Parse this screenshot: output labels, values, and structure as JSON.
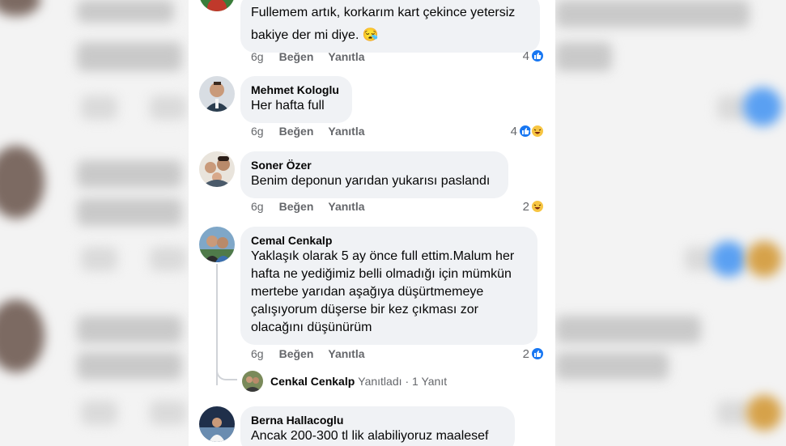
{
  "comments": [
    {
      "author": "",
      "lines": [
        "Fullemem artık, korkarım kart çekince yetersiz",
        "bakiye der mi diye. 😪"
      ],
      "time": "6g",
      "like_label": "Beğen",
      "reply_label": "Yanıtla",
      "reaction_count": "4",
      "reactions": [
        "like-icon"
      ]
    },
    {
      "author": "Mehmet Kologlu",
      "lines": [
        "Her hafta full"
      ],
      "time": "6g",
      "like_label": "Beğen",
      "reply_label": "Yanıtla",
      "reaction_count": "4",
      "reactions": [
        "like-icon",
        "haha-icon"
      ]
    },
    {
      "author": "Soner Özer",
      "lines": [
        "Benim deponun yarıdan yukarısı paslandı"
      ],
      "time": "6g",
      "like_label": "Beğen",
      "reply_label": "Yanıtla",
      "reaction_count": "2",
      "reactions": [
        "haha-icon"
      ]
    },
    {
      "author": "Cemal Cenkalp",
      "lines": [
        "Yaklaşık olarak 5 ay önce full ettim.Malum her",
        "hafta ne yediğimiz belli olmadığı için mümkün",
        "mertebe yarıdan aşağıya düşürtmemeye",
        "çalışıyorum düşerse bir kez çıkması zor",
        "olacağını düşünürüm"
      ],
      "time": "6g",
      "like_label": "Beğen",
      "reply_label": "Yanıtla",
      "reaction_count": "2",
      "reactions": [
        "like-icon"
      ],
      "reply_summary": {
        "name": "Cenkal Cenkalp",
        "action": "Yanıtladı",
        "count": "· 1 Yanıt"
      }
    },
    {
      "author": "Berna Hallacoglu",
      "lines": [
        "Ancak 200-300 tl lik alabiliyoruz maalesef"
      ]
    }
  ],
  "colors": {
    "bubble": "#f0f2f5",
    "meta_text": "#65676b",
    "like_blue": "#1877f2",
    "haha_yellow": "#f7c542"
  }
}
